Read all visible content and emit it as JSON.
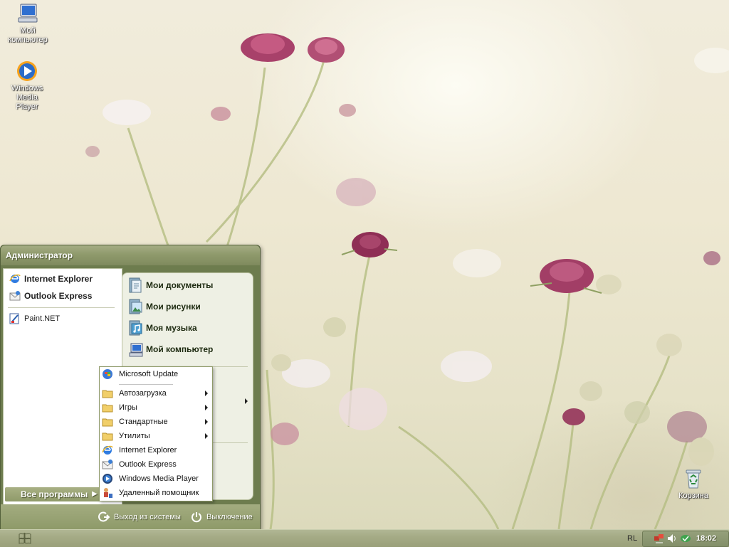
{
  "desktop": {
    "icons": [
      {
        "label_line1": "Мой",
        "label_line2": "компьютер",
        "icon": "my-computer-icon"
      },
      {
        "label_line1": "Windows Media",
        "label_line2": "Player",
        "icon": "media-player-icon"
      },
      {
        "label": "Корзина",
        "icon": "recycle-bin-icon"
      }
    ]
  },
  "start_menu": {
    "user_name": "Администратор",
    "pinned": [
      {
        "label": "Internet Explorer",
        "icon": "internet-explorer-icon"
      },
      {
        "label": "Outlook Express",
        "icon": "outlook-express-icon"
      }
    ],
    "recent": [
      {
        "label": "Paint.NET",
        "icon": "paint-net-icon"
      }
    ],
    "all_programs_label": "Все программы",
    "right_items": [
      {
        "label": "Мои документы",
        "icon": "documents-folder-icon"
      },
      {
        "label": "Мои рисунки",
        "icon": "pictures-folder-icon"
      },
      {
        "label": "Моя музыка",
        "icon": "music-folder-icon"
      },
      {
        "label": "Мой компьютер",
        "icon": "my-computer-icon"
      }
    ],
    "right_partial_text": "я",
    "logoff_label": "Выход из системы",
    "shutdown_label": "Выключение"
  },
  "programs_menu": {
    "items": [
      {
        "label": "Microsoft Update",
        "icon": "windows-update-icon",
        "submenu": false
      },
      {
        "label": "Автозагрузка",
        "icon": "folder-icon",
        "submenu": true
      },
      {
        "label": "Игры",
        "icon": "folder-icon",
        "submenu": true
      },
      {
        "label": "Стандартные",
        "icon": "folder-icon",
        "submenu": true
      },
      {
        "label": "Утилиты",
        "icon": "folder-icon",
        "submenu": true
      },
      {
        "label": "Internet Explorer",
        "icon": "internet-explorer-icon",
        "submenu": false
      },
      {
        "label": "Outlook Express",
        "icon": "outlook-express-icon",
        "submenu": false
      },
      {
        "label": "Windows Media Player",
        "icon": "media-player-icon",
        "submenu": false
      },
      {
        "label": "Удаленный помощник",
        "icon": "remote-assistance-icon",
        "submenu": false
      }
    ]
  },
  "taskbar": {
    "language": "RL",
    "clock": "18:02",
    "tray_icons": [
      "network-icon",
      "volume-icon",
      "security-icon"
    ]
  },
  "colors": {
    "theme_olive": "#6d7c4e",
    "menu_bg": "#ffffff",
    "taskbar": "#a5ab86"
  }
}
